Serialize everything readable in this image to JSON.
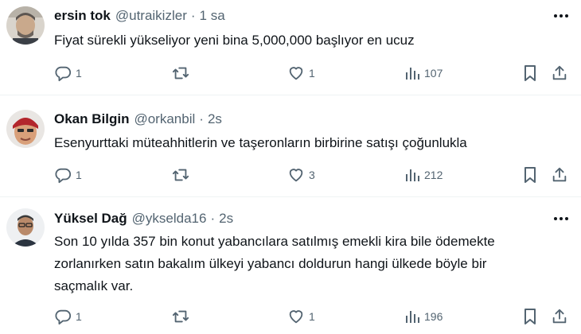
{
  "tweets": [
    {
      "name": "ersin tok",
      "handle": "@utraikizler",
      "separator": "·",
      "time": "1 sa",
      "text": "Fiyat sürekli yükseliyor yeni bina 5,000,000 başlıyor en ucuz",
      "replies": "1",
      "retweets": "",
      "likes": "1",
      "views": "107"
    },
    {
      "name": "Okan Bilgin",
      "handle": "@orkanbil",
      "separator": "·",
      "time": "2s",
      "text": "Esenyurttaki müteahhitlerin ve taşeronların birbirine satışı çoğunlukla",
      "replies": "1",
      "retweets": "",
      "likes": "3",
      "views": "212"
    },
    {
      "name": "Yüksel Dağ",
      "handle": "@ykselda16",
      "separator": "·",
      "time": "2s",
      "text_lines": [
        "Son 10 yılda 357 bin konut yabancılara satılmış emekli kira bile ödemekte",
        "zorlanırken satın bakalım ülkeyi yabancı doldurun hangi ülkede böyle bir",
        "saçmalık var."
      ],
      "replies": "1",
      "retweets": "",
      "likes": "1",
      "views": "196"
    }
  ],
  "icons": {
    "reply": "reply-icon",
    "retweet": "retweet-icon",
    "like": "heart-icon",
    "views": "views-chart-icon",
    "bookmark": "bookmark-icon",
    "share": "share-icon",
    "more": "more-options-icon"
  },
  "colors": {
    "icon": "#536471",
    "divider": "#eff3f4",
    "text": "#0f1419"
  }
}
